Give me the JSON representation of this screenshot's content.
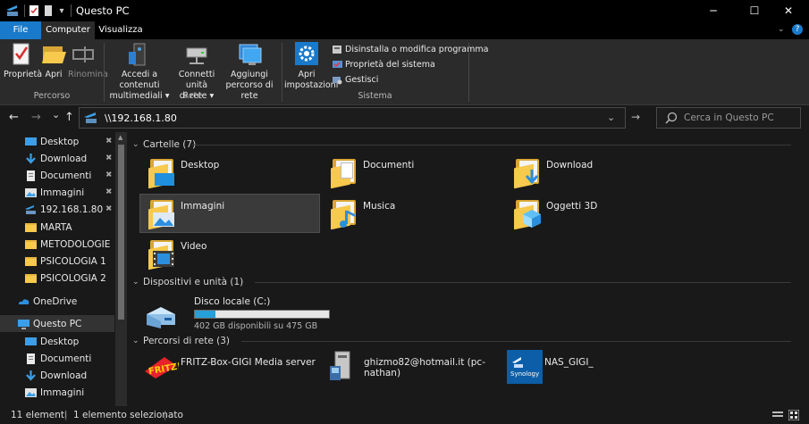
{
  "window": {
    "title": "Questo PC",
    "minimize": "─",
    "maximize": "☐",
    "close": "✕"
  },
  "tabs": {
    "file": "File",
    "computer": "Computer",
    "view": "Visualizza"
  },
  "ribbon": {
    "properties": "Proprietà",
    "open": "Apri",
    "rename": "Rinomina",
    "access_media_1": "Accedi a contenuti",
    "access_media_2": "multimediali ▾",
    "map_drive_1": "Connetti unità",
    "map_drive_2": "di rete ▾",
    "add_location_1": "Aggiungi",
    "add_location_2": "percorso di rete",
    "open_settings_1": "Apri",
    "open_settings_2": "impostazioni",
    "uninstall": "Disinstalla o modifica programma",
    "system_props": "Proprietà del sistema",
    "manage": "Gestisci",
    "group_location": "Percorso",
    "group_network": "Rete",
    "group_system": "Sistema"
  },
  "nav": {
    "back": "←",
    "forward": "→",
    "recent": "⌄",
    "up": "↑",
    "address": "\\\\192.168.1.80",
    "search_placeholder": "Cerca in Questo PC"
  },
  "sidebar": {
    "items": [
      {
        "label": "Desktop",
        "icon": "desktop-icon",
        "pinned": true
      },
      {
        "label": "Download",
        "icon": "download-icon",
        "pinned": true
      },
      {
        "label": "Documenti",
        "icon": "documents-icon",
        "pinned": true
      },
      {
        "label": "Immagini",
        "icon": "pictures-icon",
        "pinned": true
      },
      {
        "label": "192.168.1.80",
        "icon": "network-share-icon",
        "pinned": true
      },
      {
        "label": "MARTA",
        "icon": "folder-icon",
        "pinned": false
      },
      {
        "label": "METODOLOGIE",
        "icon": "folder-icon",
        "pinned": false
      },
      {
        "label": "PSICOLOGIA 1",
        "icon": "folder-icon",
        "pinned": false
      },
      {
        "label": "PSICOLOGIA 2",
        "icon": "folder-icon",
        "pinned": false
      },
      {
        "label": "OneDrive",
        "icon": "onedrive-icon",
        "pinned": false
      },
      {
        "label": "Questo PC",
        "icon": "this-pc-icon",
        "pinned": false
      },
      {
        "label": "Desktop",
        "icon": "desktop-icon",
        "pinned": false
      },
      {
        "label": "Documenti",
        "icon": "documents-icon",
        "pinned": false
      },
      {
        "label": "Download",
        "icon": "download-icon",
        "pinned": false
      },
      {
        "label": "Immagini",
        "icon": "pictures-icon",
        "pinned": false
      }
    ]
  },
  "sections": {
    "folders": "Cartelle (7)",
    "devices": "Dispositivi e unità (1)",
    "network": "Percorsi di rete (3)"
  },
  "folders": [
    {
      "label": "Desktop",
      "icon": "desktop-folder-icon"
    },
    {
      "label": "Documenti",
      "icon": "documents-folder-icon"
    },
    {
      "label": "Download",
      "icon": "download-folder-icon"
    },
    {
      "label": "Immagini",
      "icon": "pictures-folder-icon"
    },
    {
      "label": "Musica",
      "icon": "music-folder-icon"
    },
    {
      "label": "Oggetti 3D",
      "icon": "3d-objects-folder-icon"
    },
    {
      "label": "Video",
      "icon": "videos-folder-icon"
    }
  ],
  "drive": {
    "label": "Disco locale (C:)",
    "free_text": "402 GB disponibili su 475 GB",
    "used_fraction": 0.154
  },
  "network_locations": [
    {
      "label": "FRITZ-Box-GIGI Media server",
      "icon": "fritz-media-server-icon"
    },
    {
      "label": "ghizmo82@hotmail.it (pc-nathan)",
      "icon": "network-pc-icon"
    },
    {
      "label": "NAS_GIGI_",
      "icon": "synology-nas-icon",
      "badge": "Synology"
    }
  ],
  "status": {
    "count": "11 elementi",
    "selected": "1 elemento selezionato"
  },
  "colors": {
    "accent": "#1979ca",
    "folder": "#f7c94c",
    "background": "#191919"
  }
}
